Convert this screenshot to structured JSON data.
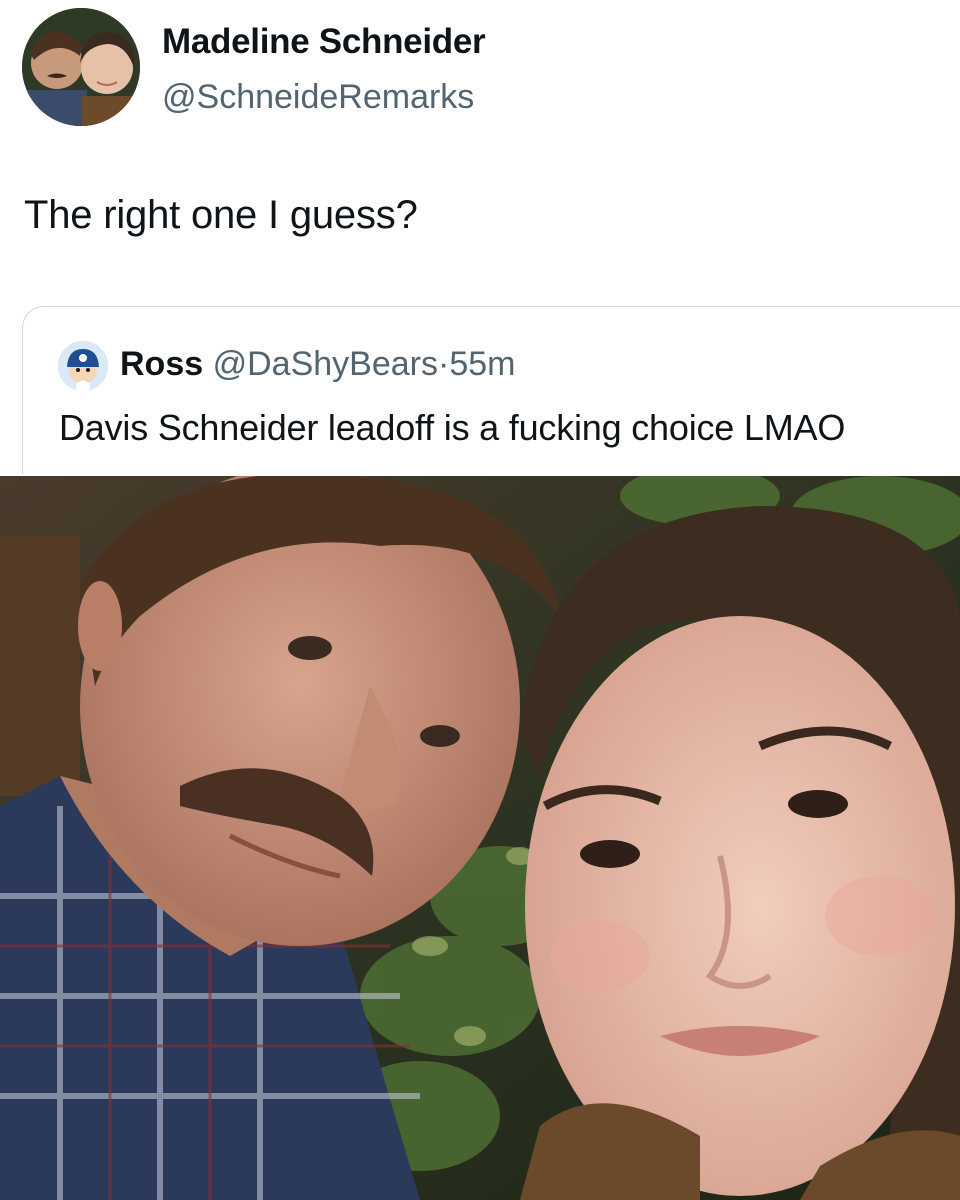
{
  "tweet": {
    "display_name": "Madeline Schneider",
    "handle": "@SchneideRemarks",
    "text": "The right one I guess?",
    "avatar_icon": "profile-avatar"
  },
  "quoted_tweet": {
    "display_name": "Ross",
    "handle": "@DaShyBears",
    "separator": "·",
    "time": "55m",
    "text": "Davis Schneider leadoff is a fucking choice LMAO",
    "avatar_icon": "cartoon-avatar"
  },
  "media": {
    "photo_icon": "selfie-photo"
  },
  "colors": {
    "primary_text": "#0f1419",
    "secondary_text": "#536471",
    "border": "#cfd9de",
    "background": "#ffffff"
  }
}
